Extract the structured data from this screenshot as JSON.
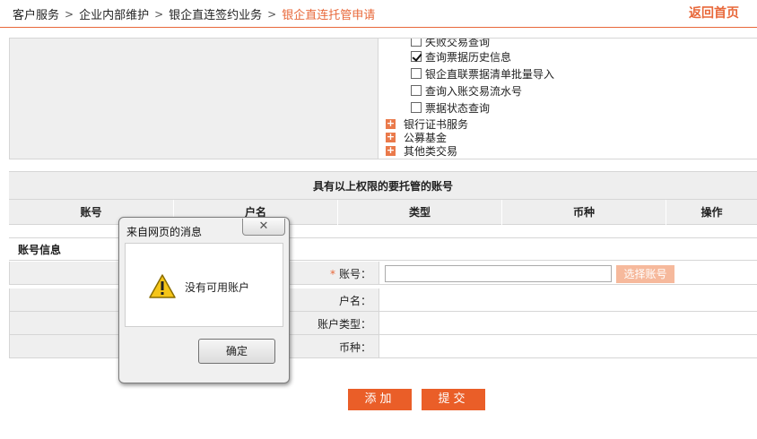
{
  "breadcrumb": {
    "items": [
      "客户服务",
      "企业内部维护",
      "银企直连签约业务",
      "银企直连托管申请"
    ],
    "separator": ">"
  },
  "header": {
    "home_link": "返回首页"
  },
  "permissions": {
    "checkboxes": [
      {
        "label": "失败交易查询",
        "checked": false
      },
      {
        "label": "查询票据历史信息",
        "checked": true
      },
      {
        "label": "银企直联票据清单批量导入",
        "checked": false
      },
      {
        "label": "查询入账交易流水号",
        "checked": false
      },
      {
        "label": "票据状态查询",
        "checked": false
      }
    ],
    "nodes": [
      {
        "label": "银行证书服务",
        "icon": "plus-expand-icon"
      },
      {
        "label": "公募基金",
        "icon": "plus-expand-icon"
      },
      {
        "label": "其他类交易",
        "icon": "plus-expand-icon"
      }
    ]
  },
  "accounts_table": {
    "title": "具有以上权限的要托管的账号",
    "columns": [
      "账号",
      "户名",
      "类型",
      "币种",
      "操作"
    ]
  },
  "account_info": {
    "title": "账号信息",
    "fields": [
      {
        "label": "账号：",
        "required_mark": "*",
        "value": ""
      },
      {
        "label": "户名：",
        "value": ""
      },
      {
        "label": "账户类型：",
        "value": ""
      },
      {
        "label": "币种：",
        "value": ""
      }
    ],
    "choose_button": "选择账号"
  },
  "actions": {
    "add": "添加",
    "submit": "提交"
  },
  "dialog": {
    "title": "来自网页的消息",
    "message": "没有可用账户",
    "ok": "确定",
    "close_glyph": "✕",
    "icon": "warning-icon"
  },
  "colors": {
    "accent": "#e8683a",
    "button": "#ea5e28",
    "button_disabled": "#f6b99c",
    "panel_bg": "#efefef"
  }
}
